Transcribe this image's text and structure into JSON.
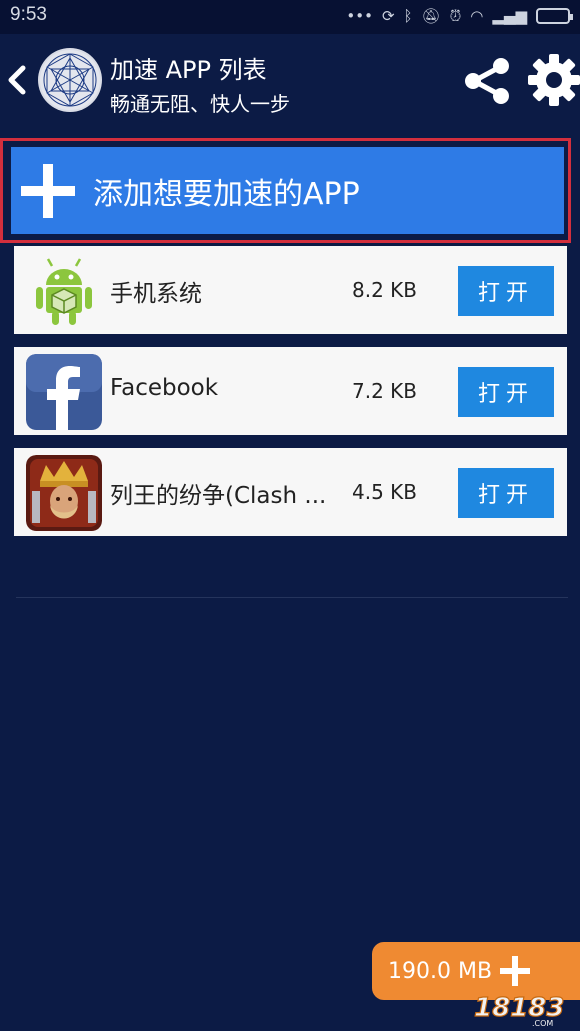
{
  "status_bar": {
    "time": "9:53"
  },
  "header": {
    "title": "加速 APP 列表",
    "subtitle": "畅通无阻、快人一步"
  },
  "add_app": {
    "label": "添加想要加速的APP"
  },
  "apps": [
    {
      "name": "手机系统",
      "size": "8.2 KB",
      "open_label": "打开",
      "icon": "android-icon"
    },
    {
      "name": "Facebook",
      "size": "7.2 KB",
      "open_label": "打开",
      "icon": "facebook-icon"
    },
    {
      "name": "列王的纷争(Clash ...",
      "size": "4.5 KB",
      "open_label": "打开",
      "icon": "clash-of-kings-icon"
    }
  ],
  "boost": {
    "label": "190.0 MB"
  },
  "watermark": {
    "text": "18183",
    "domain": ".COM"
  },
  "colors": {
    "background": "#0c1b45",
    "accent_blue": "#2e7be6",
    "open_button": "#1f88e0",
    "highlight_border": "#d32f3d",
    "boost_orange": "#ef8a32"
  }
}
